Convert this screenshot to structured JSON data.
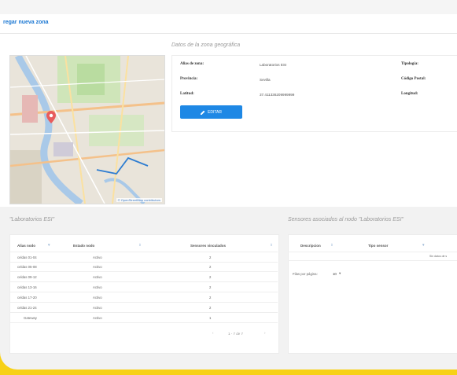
{
  "header": {
    "add_zone_link": "regar nueva zona"
  },
  "map": {
    "attribution": "© OpenStreetMap contributors"
  },
  "zone_details": {
    "title": "Datos de la zona geográfica",
    "labels": {
      "alias": "Alias de zona:",
      "province": "Provincia:",
      "latitude": "Latitud:",
      "typology": "Tipología:",
      "postal_code": "Código Postal:",
      "longitude": "Longitud:"
    },
    "values": {
      "alias": "Laboratorios ESI",
      "province": "Sevilla",
      "latitude": "37.411336209999999"
    },
    "edit_button": "EDITAR"
  },
  "nodes_section": {
    "title": "\"Laboratorios ESI\"",
    "headers": [
      "Alias nodo",
      "Estado nodo",
      "Sensores vinculados"
    ],
    "rows": [
      [
        "celdas 01-04",
        "Activo",
        "2"
      ],
      [
        "celdas 05-08",
        "Activo",
        "2"
      ],
      [
        "celdas 09-12",
        "Activo",
        "2"
      ],
      [
        "celdas 13-16",
        "Activo",
        "2"
      ],
      [
        "celdas 17-20",
        "Activo",
        "2"
      ],
      [
        "celdas 21-24",
        "Activo",
        "2"
      ],
      [
        "Gateway",
        "Activo",
        "1"
      ]
    ],
    "pagination": "1 - 7 de 7"
  },
  "sensors_section": {
    "title": "Sensores asociados al nodo \"Laboratorios ESI\"",
    "headers": [
      "Descripcion",
      "Tipo sensor"
    ],
    "empty_text": "Sin datos de s",
    "rows_per_page_label": "Filas por página:",
    "rows_per_page_value": "10"
  },
  "colors": {
    "accent": "#1e88e5",
    "brand_yellow": "#f7d117",
    "link": "#1976d2"
  }
}
